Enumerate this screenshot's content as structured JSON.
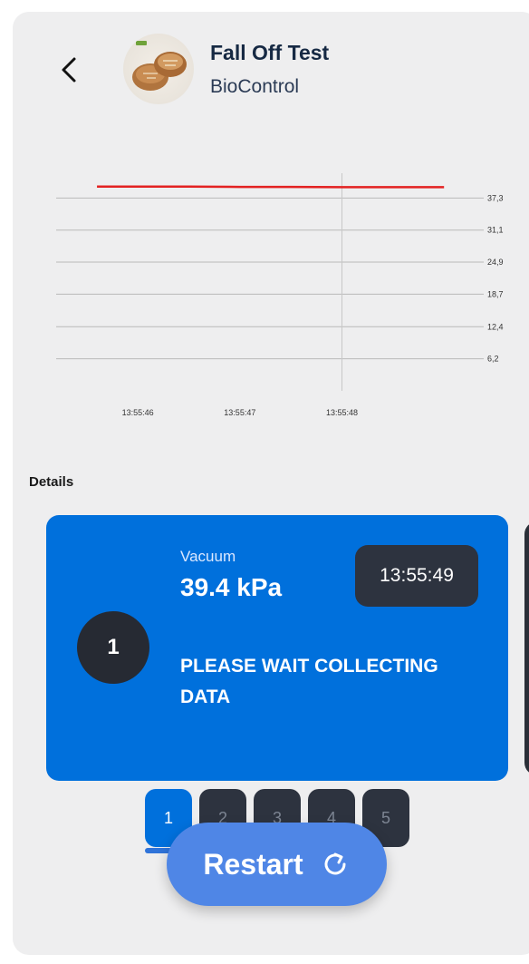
{
  "header": {
    "title": "Fall Off Test",
    "subtitle": "BioControl",
    "back_icon": "chevron-left-icon",
    "avatar": "bread-image"
  },
  "chart_data": {
    "type": "line",
    "x_ticks": [
      "13:55:46",
      "13:55:47",
      "13:55:48"
    ],
    "y_ticks": [
      "6,2",
      "12,4",
      "18,7",
      "24,9",
      "31,1",
      "37,3"
    ],
    "ylim": [
      0,
      43.5
    ],
    "grid": true,
    "series": [
      {
        "color": "#e32222",
        "x": [
          45.6,
          46.0,
          46.5,
          47.0,
          47.5,
          48.0,
          48.5,
          49.0
        ],
        "y": [
          39.5,
          39.5,
          39.5,
          39.45,
          39.45,
          39.4,
          39.4,
          39.4
        ]
      }
    ]
  },
  "details": {
    "label": "Details"
  },
  "card": {
    "step_number": "1",
    "metric_label": "Vacuum",
    "metric_value": "39.4 kPa",
    "time": "13:55:49",
    "status": "PLEASE WAIT COLLECTING DATA"
  },
  "pager": {
    "pages": [
      "1",
      "2",
      "3",
      "4",
      "5"
    ],
    "active": "1"
  },
  "restart": {
    "label": "Restart",
    "icon": "refresh-icon"
  },
  "colors": {
    "accent": "#0070dc",
    "dark": "#2d333f",
    "fab": "#4f86e6",
    "line": "#e32222"
  }
}
